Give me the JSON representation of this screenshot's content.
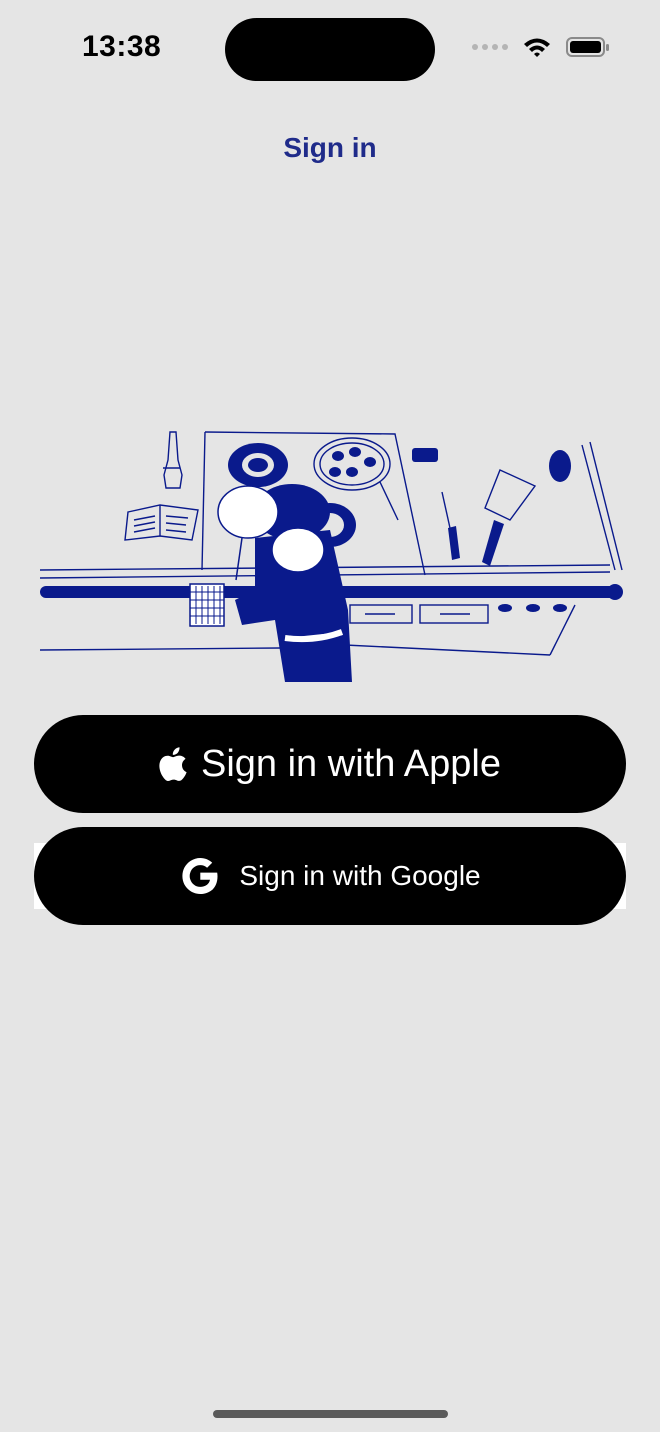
{
  "status_bar": {
    "time": "13:38"
  },
  "header": {
    "title": "Sign in"
  },
  "illustration": {
    "icon": "kitchen-illustration"
  },
  "buttons": {
    "apple_label": "Sign in with Apple",
    "google_label": "Sign in with Google"
  },
  "colors": {
    "background": "#e5e5e5",
    "accent": "#1f2b8a",
    "illustration_ink": "#0a1a8c",
    "button_bg": "#000000",
    "button_text": "#ffffff"
  }
}
